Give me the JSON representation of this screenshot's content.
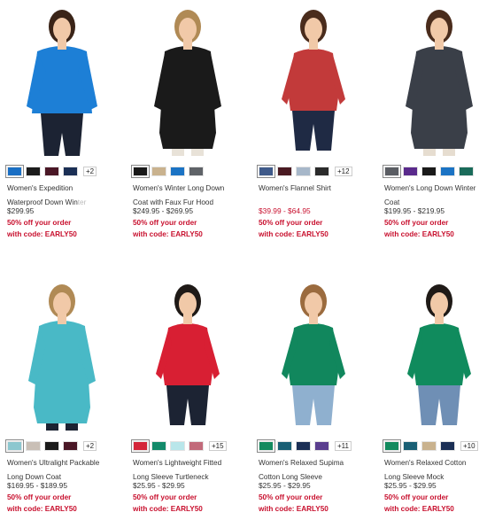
{
  "products": [
    {
      "name_l1": "Women's Expedition",
      "name_l2": "Waterproof Down Win",
      "name_fade": "ter",
      "price": "$299.95",
      "promo_l1": "50% off your order",
      "promo_l2": "with code: EARLY50",
      "swatches": [
        "#1a6fc4",
        "#1c1c1c",
        "#4a1726",
        "#1b2f55"
      ],
      "more": "+2",
      "colors": {
        "coat": "#1d7fd6",
        "pants": "#1c2333",
        "hair": "#3a2418"
      }
    },
    {
      "name_l1": "Women's Winter Long Down",
      "name_l2": "Coat with Faux Fur Hood",
      "name_fade": "",
      "price": "$249.95 - $269.95",
      "promo_l1": "50% off your order",
      "promo_l2": "with code: EARLY50",
      "swatches": [
        "#1a1a1a",
        "#c9b28e",
        "#1b73c4",
        "#5f6368"
      ],
      "more": "",
      "colors": {
        "coat": "#1a1a1a",
        "pants": "#e8e2d8",
        "hair": "#b08a55"
      }
    },
    {
      "name_l1": "Women's Flannel Shirt",
      "name_l2": "",
      "name_fade": "",
      "price": "$39.99 - $64.95",
      "promo_l1": "50% off your order",
      "promo_l2": "with code: EARLY50",
      "swatches": [
        "#3f5a8a",
        "#4a1a22",
        "#a7b7c9",
        "#2b2b2b"
      ],
      "more": "+12",
      "colors": {
        "coat": "#c23a3a",
        "pants": "#1f2a44",
        "hair": "#4a2c1c"
      }
    },
    {
      "name_l1": "Women's Long Down Winter",
      "name_l2": "Coat",
      "name_fade": "",
      "price": "$199.95 - $219.95",
      "promo_l1": "50% off your order",
      "promo_l2": "with code: EARLY50",
      "swatches": [
        "#5a5d63",
        "#5a2a8c",
        "#1a1a1a",
        "#1b73c4",
        "#1a6b5a"
      ],
      "more": "",
      "colors": {
        "coat": "#3a3f48",
        "pants": "#e6ddd0",
        "hair": "#4a2c1c"
      }
    },
    {
      "name_l1": "Women's Ultralight Packable",
      "name_l2": "Long Down Coat",
      "name_fade": "",
      "price": "$169.95 - $189.95",
      "promo_l1": "50% off your order",
      "promo_l2": "with code: EARLY50",
      "swatches": [
        "#8cc7cf",
        "#c9bfb6",
        "#1a1a1a",
        "#4a1726"
      ],
      "more": "+2",
      "colors": {
        "coat": "#49b9c6",
        "pants": "#1c2333",
        "hair": "#b08a55"
      }
    },
    {
      "name_l1": "Women's Lightweight Fitted",
      "name_l2": "Long Sleeve Turtleneck",
      "name_fade": "",
      "price": "$25.95 - $29.95",
      "promo_l1": "50% off your order",
      "promo_l2": "with code: EARLY50",
      "swatches": [
        "#d4263a",
        "#138a6a",
        "#b9e6ea",
        "#c26a7a"
      ],
      "more": "+15",
      "colors": {
        "coat": "#d81f33",
        "pants": "#1c2333",
        "hair": "#1f1a17"
      }
    },
    {
      "name_l1": "Women's Relaxed Supima",
      "name_l2": "Cotton Long Sleeve",
      "name_fade": "",
      "price": "$25.95 - $29.95",
      "promo_l1": "50% off your order",
      "promo_l2": "with code: EARLY50",
      "swatches": [
        "#128a5e",
        "#1a5f74",
        "#1b2f55",
        "#5a3e8e"
      ],
      "more": "+11",
      "colors": {
        "coat": "#11875d",
        "pants": "#8fb0cf",
        "hair": "#9b6b3e"
      }
    },
    {
      "name_l1": "Women's Relaxed Cotton",
      "name_l2": "Long Sleeve Mock",
      "name_fade": "",
      "price": "$25.95 - $29.95",
      "promo_l1": "50% off your order",
      "promo_l2": "with code: EARLY50",
      "swatches": [
        "#128a5e",
        "#1a5f74",
        "#c9b28e",
        "#1b2f55"
      ],
      "more": "+10",
      "colors": {
        "coat": "#108b5d",
        "pants": "#6f8fb5",
        "hair": "#1f1a17"
      }
    }
  ],
  "sale_prices": [
    2
  ]
}
